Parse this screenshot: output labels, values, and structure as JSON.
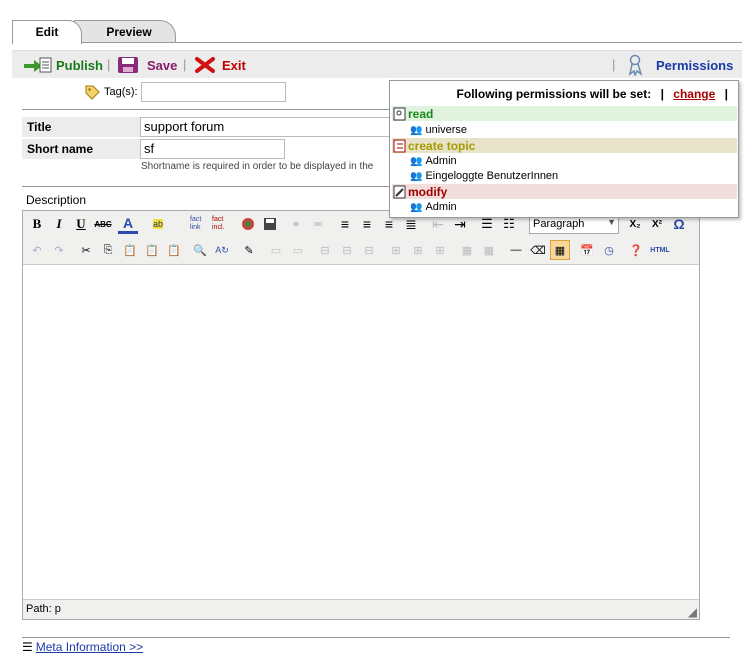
{
  "tabs": {
    "edit": "Edit",
    "preview": "Preview"
  },
  "toolbar": {
    "publish": "Publish",
    "save": "Save",
    "exit": "Exit",
    "permissions": "Permissions",
    "sep": "|"
  },
  "form": {
    "tags_label": "Tag(s):",
    "tags_value": "",
    "title_label": "Title",
    "title_value": "support forum",
    "shortname_label": "Short name",
    "shortname_value": "sf",
    "shortname_hint": "Shortname is required in order to be displayed in the",
    "description_label": "Description"
  },
  "editor": {
    "format_select": "Paragraph",
    "status_path": "Path: p",
    "colors": {
      "toolbar_bg": "#f0f0ee"
    }
  },
  "permissions": {
    "heading": "Following permissions will be set:",
    "change": "change",
    "pipe": "|",
    "groups": [
      {
        "name": "read",
        "color": "#1a8a1a",
        "bg": "#dff3df",
        "members": [
          "universe"
        ]
      },
      {
        "name": "create topic",
        "color": "#a89a00",
        "bg": "#e6e3c8",
        "members": [
          "Admin",
          "Eingeloggte BenutzerInnen"
        ]
      },
      {
        "name": "modify",
        "color": "#a00000",
        "bg": "#f3dede",
        "members": [
          "Admin"
        ]
      }
    ]
  },
  "footer": {
    "meta": "Meta Information >>"
  }
}
